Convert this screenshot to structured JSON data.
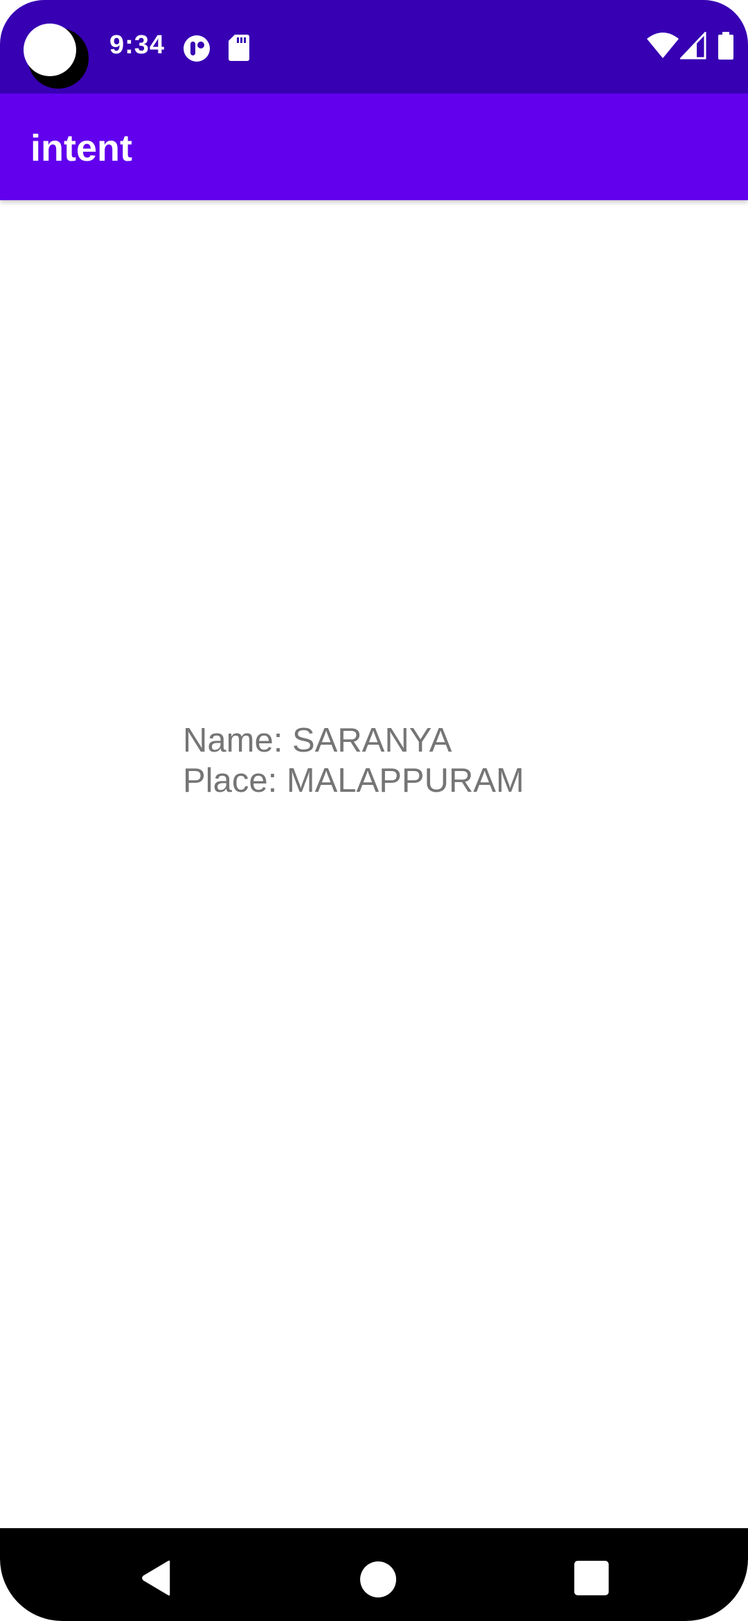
{
  "status_bar": {
    "time": "9:34",
    "icons": [
      "camera-cutout",
      "notification-app-icon",
      "sd-card-icon",
      "wifi-icon",
      "cellular-signal-icon",
      "battery-icon"
    ]
  },
  "app_bar": {
    "title": "intent"
  },
  "content": {
    "name_line": "Name: SARANYA",
    "place_line": "Place: MALAPPURAM"
  },
  "nav_bar": {
    "buttons": [
      "back-icon",
      "home-icon",
      "recents-icon"
    ]
  },
  "colors": {
    "status_bar": "#3700b3",
    "app_bar": "#6200ee",
    "text_secondary": "#757575",
    "nav_bar": "#000000"
  }
}
